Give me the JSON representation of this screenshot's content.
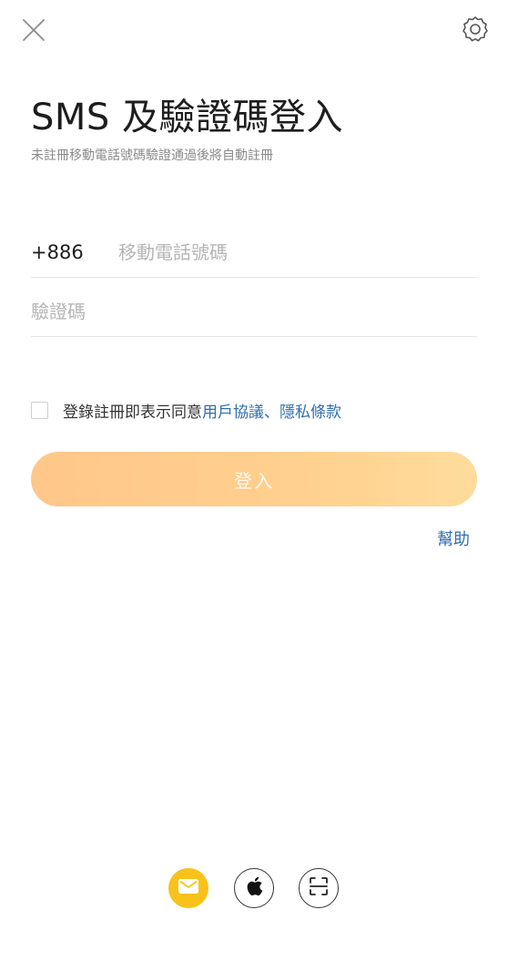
{
  "header": {
    "close_icon": "close-icon",
    "settings_icon": "gear-icon"
  },
  "title": "SMS 及驗證碼登入",
  "subtitle": "未註冊移動電話號碼驗證通過後將自動註冊",
  "phone": {
    "country_code": "+886",
    "placeholder": "移動電話號碼",
    "value": ""
  },
  "code": {
    "placeholder": "驗證碼",
    "value": ""
  },
  "agreement": {
    "checked": false,
    "prefix": "登錄註冊即表示同意",
    "user_agreement": "用戶協議",
    "separator": "、",
    "privacy_policy": "隱私條款"
  },
  "login_button": "登入",
  "help": "幫助",
  "methods": [
    {
      "icon": "mail-icon",
      "color": "#f9c21b"
    },
    {
      "icon": "apple-icon"
    },
    {
      "icon": "scan-icon"
    }
  ],
  "colors": {
    "accent_link": "#2f6fb0",
    "button_gradient_start": "#ffc78a",
    "button_gradient_end": "#ffdc9c"
  }
}
